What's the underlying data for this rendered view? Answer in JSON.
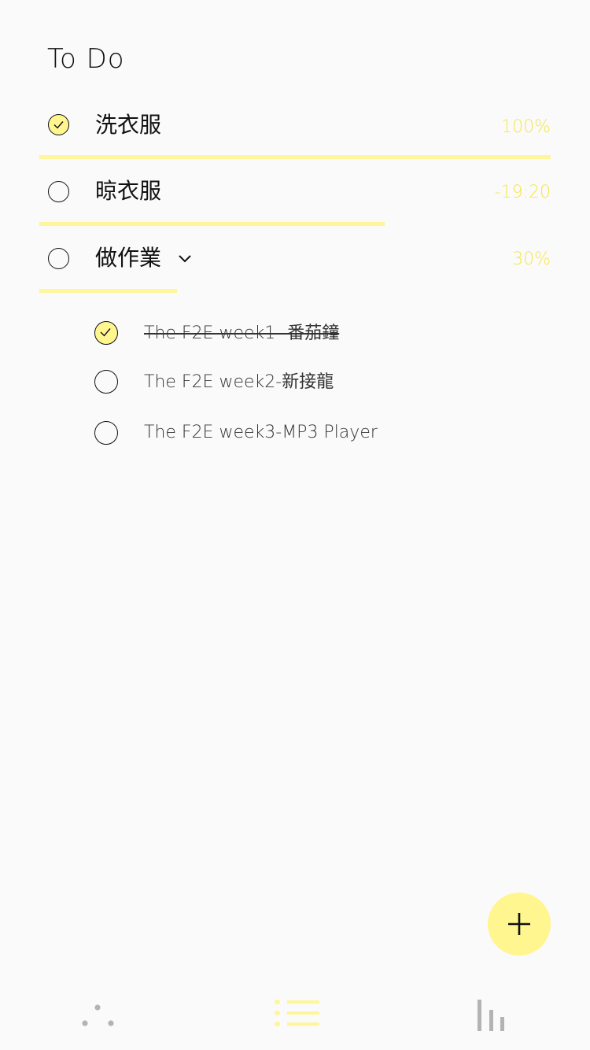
{
  "header": {
    "title": "To Do"
  },
  "tasks": [
    {
      "label": "洗衣服",
      "meta": "100%",
      "done": true,
      "progress": 1.0
    },
    {
      "label": "晾衣服",
      "meta": "-19:20",
      "done": false,
      "progress": 0.675
    },
    {
      "label": "做作業",
      "meta": "30%",
      "done": false,
      "progress": 0.27,
      "expanded": true
    }
  ],
  "subtasks": [
    {
      "label": "The F2E week1 -番茄鐘",
      "done": true
    },
    {
      "label": "The F2E week2-新接龍",
      "done": false
    },
    {
      "label": "The F2E week3-MP3 Player",
      "done": false
    }
  ],
  "fab": {
    "icon": "plus-icon"
  },
  "bottom_nav": {
    "items": [
      {
        "icon": "dots-icon",
        "active": false
      },
      {
        "icon": "list-icon",
        "active": true
      },
      {
        "icon": "stats-icon",
        "active": false
      }
    ]
  },
  "colors": {
    "accent": "#fff68f",
    "accent_text": "#f5e64b",
    "progress": "#fff59a",
    "background": "#fafafa",
    "inactive_icon": "#b3b3b3"
  }
}
